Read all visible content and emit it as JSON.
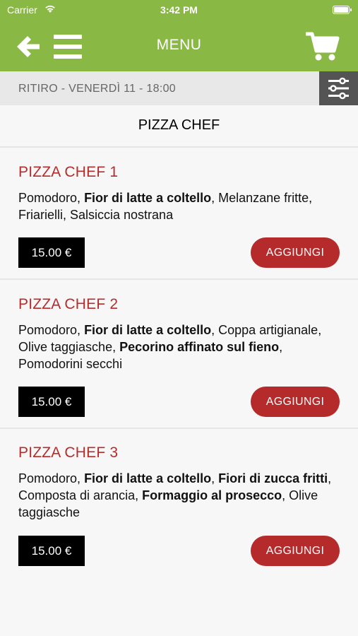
{
  "status_bar": {
    "carrier": "Carrier",
    "time": "3:42 PM"
  },
  "nav": {
    "title": "MENU",
    "back_icon": "arrow-left-icon",
    "menu_icon": "hamburger-icon",
    "cart_icon": "cart-icon"
  },
  "pickup": {
    "text": "RITIRO - VENERDÌ 11 - 18:00",
    "filter_icon": "sliders-icon"
  },
  "category": {
    "title": "PIZZA CHEF"
  },
  "colors": {
    "header_green": "#89b844",
    "accent_red": "#b52a2b",
    "price_bg": "#000000",
    "filter_bg": "#545454"
  },
  "items": [
    {
      "name": "PIZZA CHEF 1",
      "desc": [
        {
          "t": "Pomodoro, ",
          "b": false
        },
        {
          "t": "Fior di latte a coltello",
          "b": true
        },
        {
          "t": ", Melanzane fritte, Friarielli, Salsiccia nostrana",
          "b": false
        }
      ],
      "price": "15.00 €",
      "button": "AGGIUNGI"
    },
    {
      "name": "PIZZA CHEF 2",
      "desc": [
        {
          "t": "Pomodoro, ",
          "b": false
        },
        {
          "t": "Fior di latte a coltello",
          "b": true
        },
        {
          "t": ", Coppa artigianale, Olive taggiasche, ",
          "b": false
        },
        {
          "t": "Pecorino affinato sul fieno",
          "b": true
        },
        {
          "t": ", Pomodorini secchi",
          "b": false
        }
      ],
      "price": "15.00 €",
      "button": "AGGIUNGI"
    },
    {
      "name": "PIZZA CHEF 3",
      "desc": [
        {
          "t": "Pomodoro, ",
          "b": false
        },
        {
          "t": "Fior di latte a coltello",
          "b": true
        },
        {
          "t": ", ",
          "b": false
        },
        {
          "t": "Fiori di zucca fritti",
          "b": true
        },
        {
          "t": ", Composta di arancia, ",
          "b": false
        },
        {
          "t": "Formaggio al prosecco",
          "b": true
        },
        {
          "t": ", Olive taggiasche",
          "b": false
        }
      ],
      "price": "15.00 €",
      "button": "AGGIUNGI"
    }
  ]
}
